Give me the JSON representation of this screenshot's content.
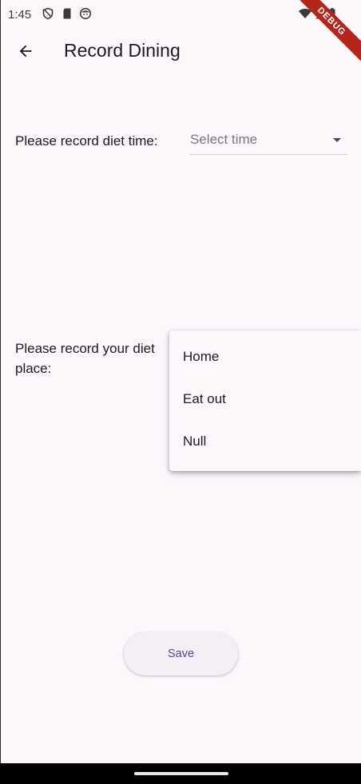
{
  "status_bar": {
    "time": "1:45",
    "left_icons": [
      "shield-icon",
      "sd-card-icon",
      "face-icon"
    ],
    "right_icons": [
      "wifi-icon",
      "signal-icon",
      "battery-icon"
    ]
  },
  "debug_banner": "DEBUG",
  "app_bar": {
    "title": "Record Dining",
    "back_icon": "arrow-back-icon"
  },
  "form": {
    "time_label": "Please record diet time:",
    "time_placeholder": "Select time",
    "place_label_line1": "Please record your diet",
    "place_label_line2": "place:"
  },
  "place_menu": {
    "options": [
      "Home",
      "Eat out",
      "Null"
    ]
  },
  "save_label": "Save",
  "colors": {
    "background": "#fdf7fc",
    "accent": "#5a4593",
    "debug": "#b3261e"
  }
}
